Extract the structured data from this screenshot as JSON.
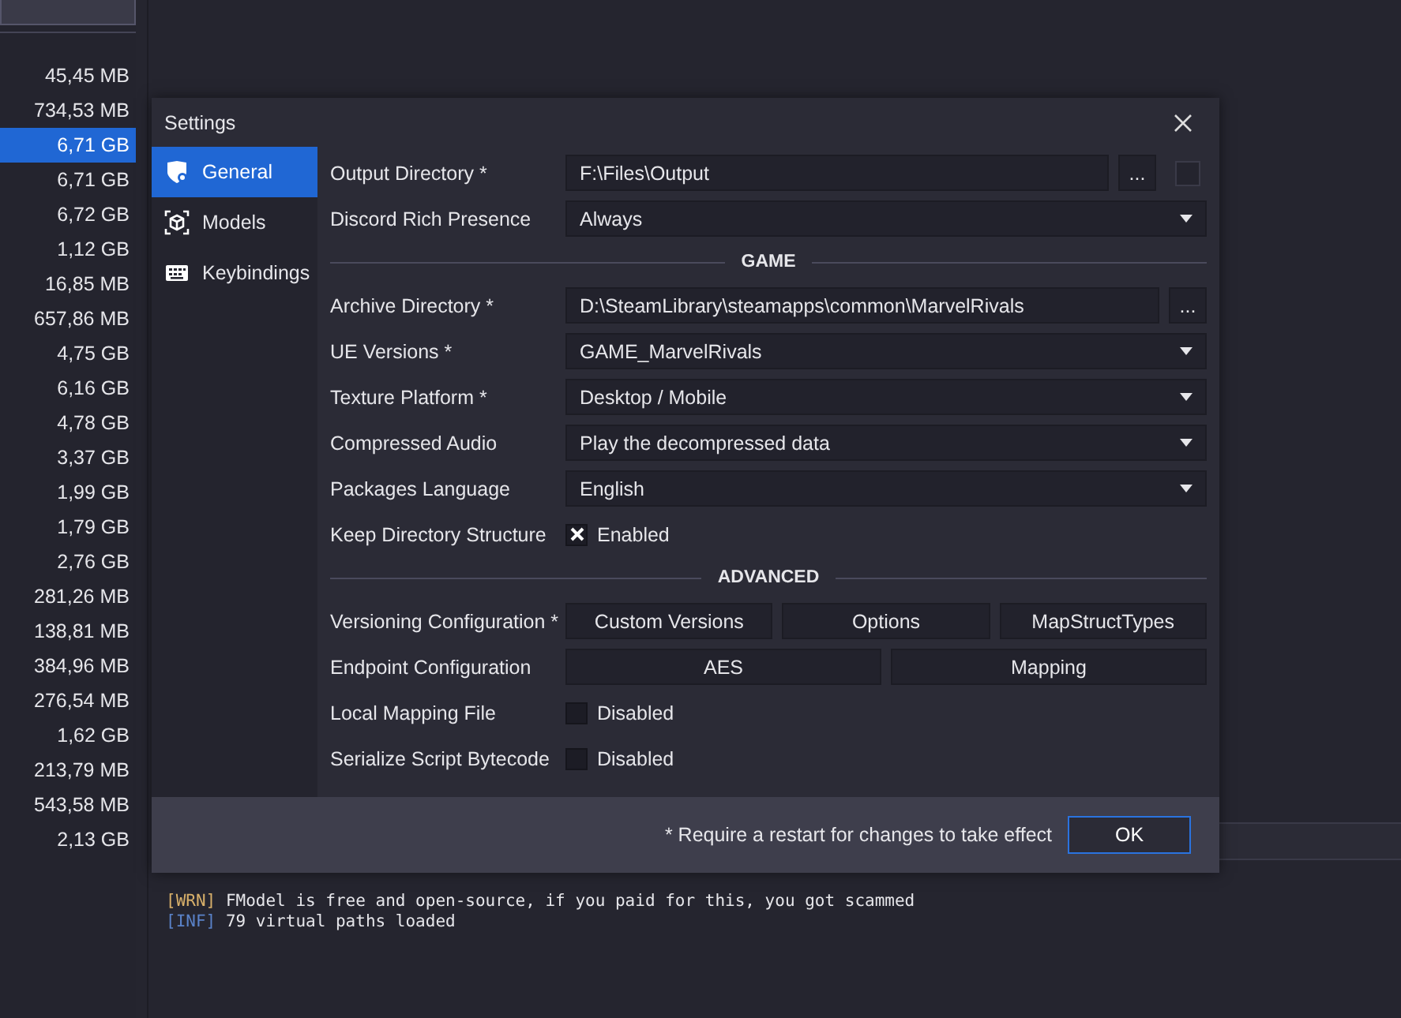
{
  "file_sizes": [
    {
      "size": "45,45 MB",
      "selected": false
    },
    {
      "size": "734,53 MB",
      "selected": false
    },
    {
      "size": "6,71 GB",
      "selected": true
    },
    {
      "size": "6,71 GB",
      "selected": false
    },
    {
      "size": "6,72 GB",
      "selected": false
    },
    {
      "size": "1,12 GB",
      "selected": false
    },
    {
      "size": "16,85 MB",
      "selected": false
    },
    {
      "size": "657,86 MB",
      "selected": false
    },
    {
      "size": "4,75 GB",
      "selected": false
    },
    {
      "size": "6,16 GB",
      "selected": false
    },
    {
      "size": "4,78 GB",
      "selected": false
    },
    {
      "size": "3,37 GB",
      "selected": false
    },
    {
      "size": "1,99 GB",
      "selected": false
    },
    {
      "size": "1,79 GB",
      "selected": false
    },
    {
      "size": "2,76 GB",
      "selected": false
    },
    {
      "size": "281,26 MB",
      "selected": false
    },
    {
      "size": "138,81 MB",
      "selected": false
    },
    {
      "size": "384,96 MB",
      "selected": false
    },
    {
      "size": "276,54 MB",
      "selected": false
    },
    {
      "size": "1,62 GB",
      "selected": false
    },
    {
      "size": "213,79 MB",
      "selected": false
    },
    {
      "size": "543,58 MB",
      "selected": false
    },
    {
      "size": "2,13 GB",
      "selected": false
    }
  ],
  "log": [
    {
      "kind": "warn",
      "tag": "[WRN]",
      "text": "FModel is free and open-source, if you paid for this, you got scammed"
    },
    {
      "kind": "info",
      "tag": "[INF]",
      "text": "79 virtual paths loaded"
    }
  ],
  "settings": {
    "title": "Settings",
    "nav": [
      {
        "kind": "shield",
        "label": "General",
        "selected": true
      },
      {
        "kind": "cube",
        "label": "Models",
        "selected": false
      },
      {
        "kind": "keyboard",
        "label": "Keybindings",
        "selected": false
      }
    ],
    "rows": [
      {
        "kind": "path",
        "label": "Output Directory *",
        "value": "F:\\Files\\Output",
        "browse": "...",
        "extra_checked": false
      },
      {
        "kind": "dropdown",
        "label": "Discord Rich Presence",
        "value": "Always"
      },
      {
        "kind": "section",
        "label": "GAME"
      },
      {
        "kind": "path",
        "label": "Archive Directory *",
        "value": "D:\\SteamLibrary\\steamapps\\common\\MarvelRivals",
        "browse": "..."
      },
      {
        "kind": "dropdown",
        "label": "UE Versions *",
        "value": "GAME_MarvelRivals"
      },
      {
        "kind": "dropdown",
        "label": "Texture Platform *",
        "value": "Desktop / Mobile"
      },
      {
        "kind": "dropdown",
        "label": "Compressed Audio",
        "value": "Play the decompressed data"
      },
      {
        "kind": "dropdown",
        "label": "Packages Language",
        "value": "English"
      },
      {
        "kind": "checkbox",
        "label": "Keep Directory Structure",
        "checked": true,
        "text": "Enabled"
      },
      {
        "kind": "section",
        "label": "ADVANCED"
      },
      {
        "kind": "buttons",
        "label": "Versioning Configuration *",
        "buttons": [
          "Custom Versions",
          "Options",
          "MapStructTypes"
        ]
      },
      {
        "kind": "buttons",
        "label": "Endpoint Configuration",
        "buttons": [
          "AES",
          "Mapping"
        ]
      },
      {
        "kind": "checkbox",
        "label": "Local Mapping File",
        "checked": false,
        "text": "Disabled"
      },
      {
        "kind": "checkbox",
        "label": "Serialize Script Bytecode",
        "checked": false,
        "text": "Disabled"
      }
    ],
    "footer_note": "* Require a restart for changes to take effect",
    "ok": "OK"
  }
}
